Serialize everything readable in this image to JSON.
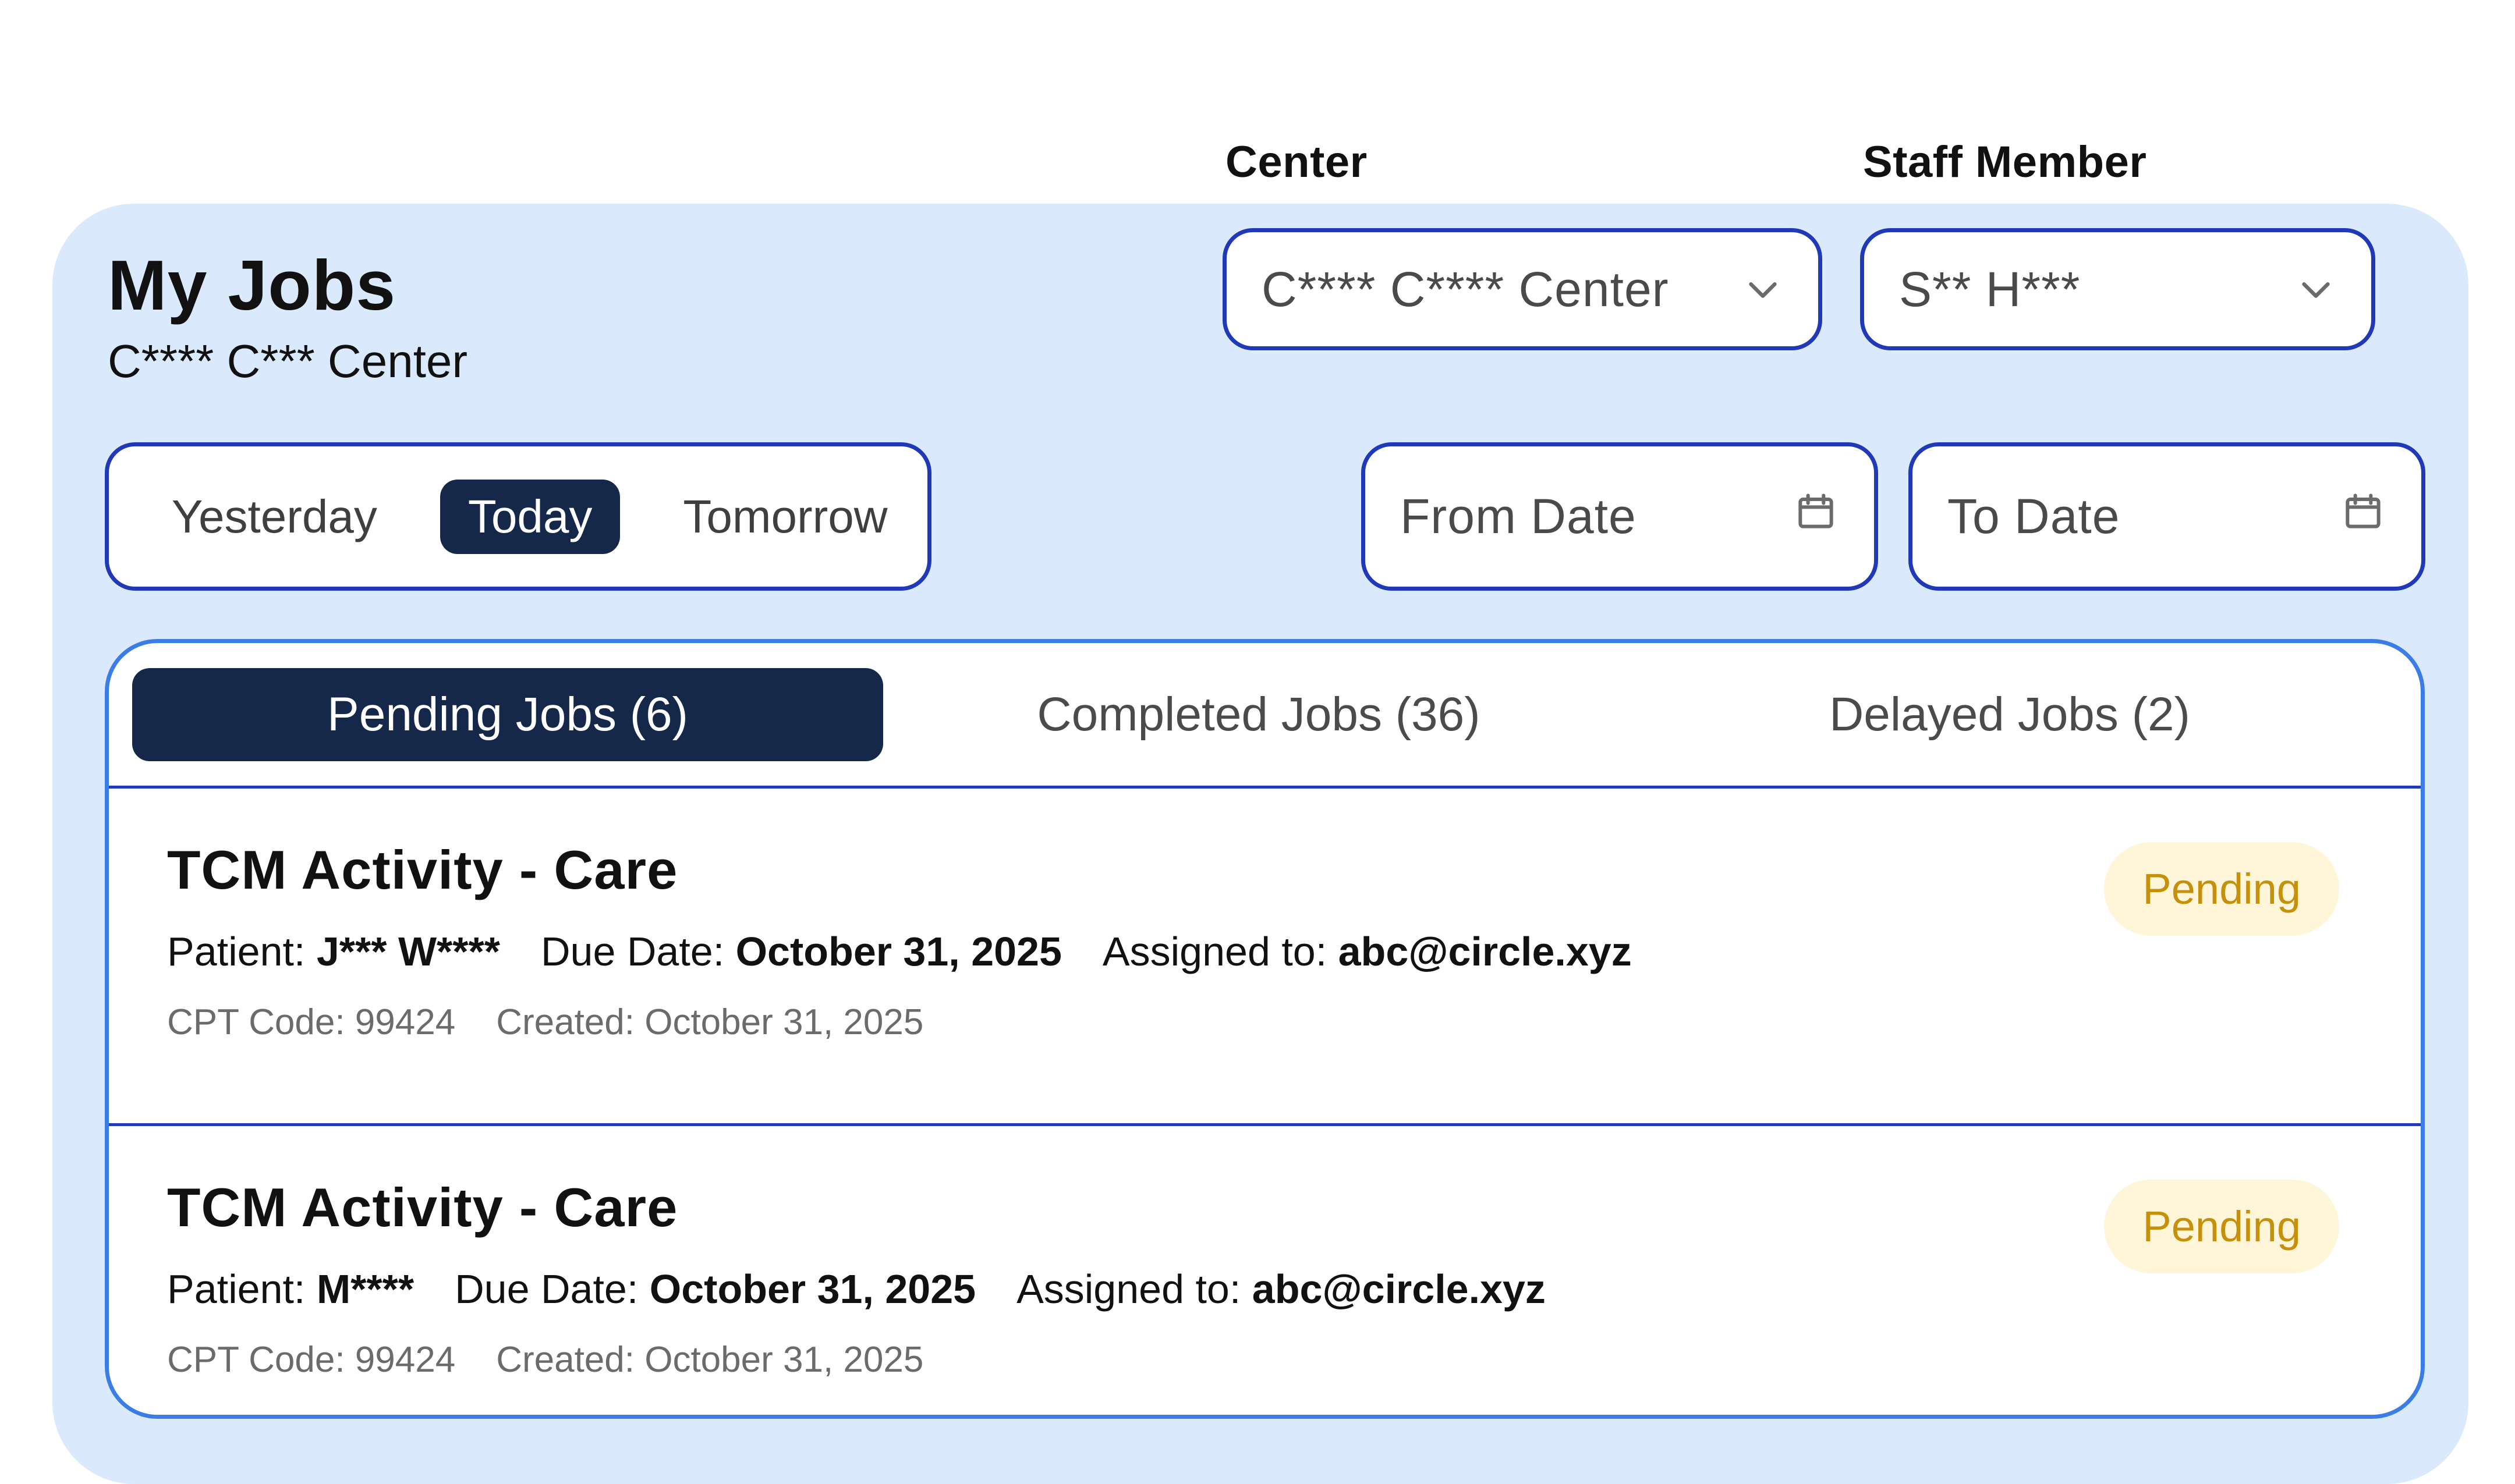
{
  "filters": {
    "center_label": "Center",
    "center_value": "C**** C****  Center",
    "staff_label": "Staff Member",
    "staff_value": "S** H***"
  },
  "header": {
    "title": "My Jobs",
    "subtitle": "C**** C*** Center"
  },
  "range": {
    "options": [
      "Yesterday",
      "Today",
      "Tomorrow"
    ],
    "selected": "Today"
  },
  "dates": {
    "from": "From Date",
    "to": "To Date"
  },
  "tabs": [
    {
      "label": "Pending Jobs (6)",
      "active": true
    },
    {
      "label": "Completed Jobs (36)",
      "active": false
    },
    {
      "label": "Delayed Jobs (2)",
      "active": false
    }
  ],
  "jobs": [
    {
      "title": "TCM Activity - Care",
      "patient_label": "Patient:",
      "patient": "J*** W****",
      "due_label": "Due Date:",
      "due": "October 31, 2025",
      "assigned_label": "Assigned to:",
      "assigned": "abc@circle.xyz",
      "cpt": "CPT Code: 99424",
      "created_label": "Created:",
      "created": "October 31, 2025",
      "status": "Pending"
    },
    {
      "title": "TCM Activity - Care",
      "patient_label": "Patient:",
      "patient": "M****",
      "due_label": "Due Date:",
      "due": "October 31, 2025",
      "assigned_label": "Assigned to:",
      "assigned": "abc@circle.xyz",
      "cpt": "CPT Code: 99424",
      "created_label": "Created:",
      "created": "October 31, 2025",
      "status": "Pending"
    }
  ],
  "icons": {
    "chevron": "chevron-down-icon",
    "calendar": "calendar-icon"
  },
  "colors": {
    "panel": "#dbe9fd",
    "navy": "#16284a",
    "border": "#1f39b8",
    "pending_text": "#c7900a",
    "pending_bg": "#fff6d9"
  }
}
